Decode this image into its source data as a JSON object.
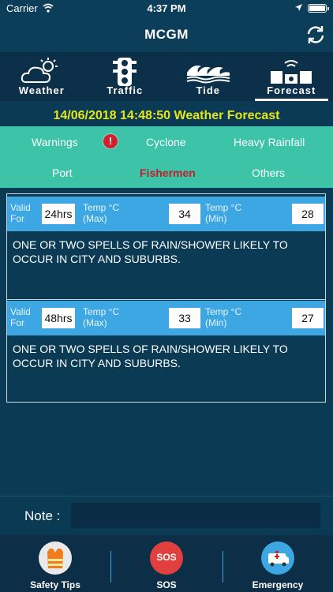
{
  "status": {
    "carrier": "Carrier",
    "time": "4:37 PM"
  },
  "nav": {
    "title": "MCGM"
  },
  "tabs": [
    {
      "label": "Weather",
      "icon": "weather-icon"
    },
    {
      "label": "Traffic",
      "icon": "traffic-light-icon"
    },
    {
      "label": "Tide",
      "icon": "wave-icon"
    },
    {
      "label": "Forecast",
      "icon": "forecast-icon",
      "active": true
    }
  ],
  "forecast_title": "14/06/2018 14:48:50 Weather Forecast",
  "categories": {
    "warnings": "Warnings",
    "cyclone": "Cyclone",
    "heavy_rainfall": "Heavy Rainfall",
    "port": "Port",
    "fishermen": "Fishermen",
    "others": "Others",
    "active": "Fishermen"
  },
  "cards": [
    {
      "valid_label": "Valid",
      "for_label": "For",
      "hours": "24hrs",
      "temp_label": "Temp °C",
      "max_label": "(Max)",
      "min_label": "(Min)",
      "max": "34",
      "min": "28",
      "text": "ONE OR TWO SPELLS OF RAIN/SHOWER LIKELY TO OCCUR IN CITY AND SUBURBS."
    },
    {
      "valid_label": "Valid",
      "for_label": "For",
      "hours": "48hrs",
      "temp_label": "Temp °C",
      "max_label": "(Max)",
      "min_label": "(Min)",
      "max": "33",
      "min": "27",
      "text": "ONE OR TWO SPELLS OF RAIN/SHOWER LIKELY TO OCCUR IN CITY AND SUBURBS."
    }
  ],
  "note": {
    "label": "Note :",
    "value": ""
  },
  "bottom": {
    "safety": "Safety Tips",
    "sos": "SOS",
    "sos_badge": "SOS",
    "emergency": "Emergency"
  },
  "colors": {
    "background": "#0b3a55",
    "category_panel": "#3cc3a8",
    "card_header": "#3da7e4",
    "title_yellow": "#e6e616",
    "active_red": "#c0202d"
  }
}
